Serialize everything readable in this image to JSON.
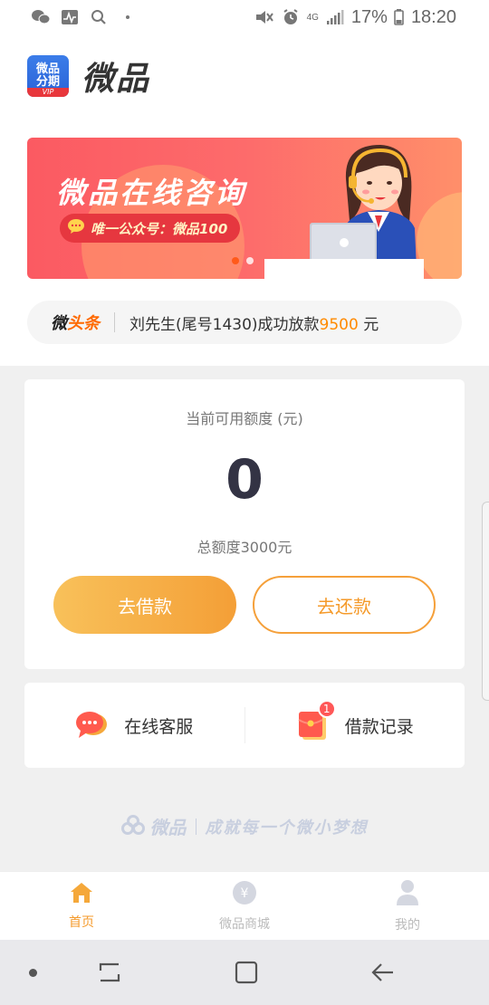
{
  "status_bar": {
    "battery_percent": "17%",
    "time": "18:20",
    "network": "4G",
    "icons": [
      "wechat-icon",
      "activity-icon",
      "search-icon",
      "mute-icon",
      "alarm-icon",
      "signal-icon",
      "battery-icon"
    ]
  },
  "header": {
    "logo_line1": "微品",
    "logo_line2": "分期",
    "logo_vip": "VIP",
    "brand_name": "微品"
  },
  "banner": {
    "title": "微品在线咨询",
    "pill_text": "唯一公众号：微品100",
    "slides": 2,
    "active_slide": 1,
    "colors": {
      "start": "#fb5a62",
      "end": "#ff8f6a",
      "pill": "#e6373f"
    }
  },
  "ticker": {
    "tag_part1": "微",
    "tag_part2": "头条",
    "text_before": "刘先生(尾号1430)成功放款",
    "amount": "9500",
    "text_after": " 元"
  },
  "credit": {
    "label": "当前可用额度 (元)",
    "value": "0",
    "total": "总额度3000元",
    "borrow_button": "去借款",
    "repay_button": "去还款",
    "accent": "#f59a2a"
  },
  "services": {
    "items": [
      {
        "label": "在线客服",
        "icon": "chat-bubble-icon"
      },
      {
        "label": "借款记录",
        "icon": "red-envelope-icon",
        "badge": "1"
      }
    ]
  },
  "slogan": {
    "brand": "微品",
    "text": "成就每一个微小梦想"
  },
  "tabbar": {
    "tabs": [
      {
        "label": "首页",
        "icon": "home-icon",
        "active": true
      },
      {
        "label": "微品商城",
        "icon": "yuan-coin-icon",
        "active": false
      },
      {
        "label": "我的",
        "icon": "user-icon",
        "active": false
      }
    ]
  }
}
